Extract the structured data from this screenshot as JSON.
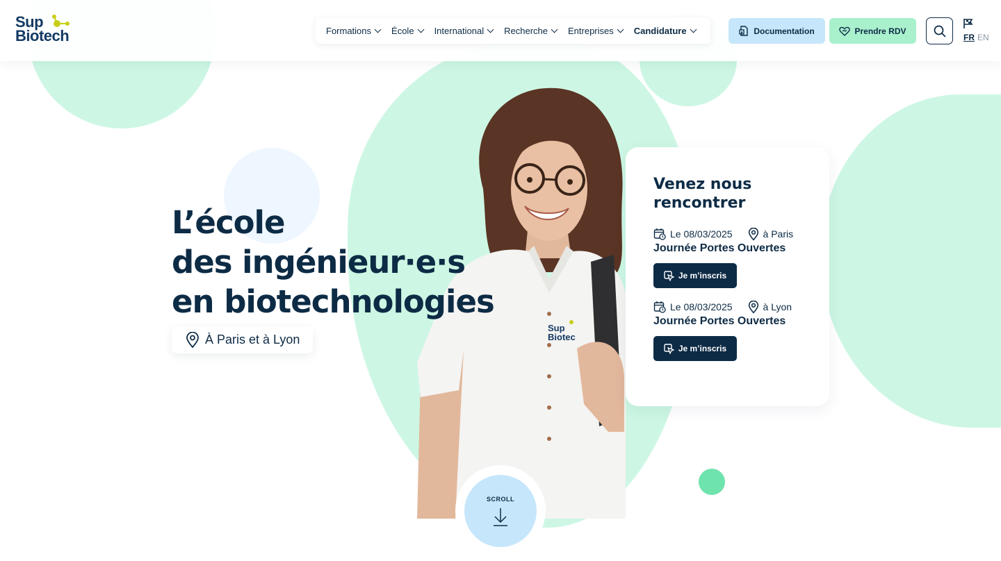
{
  "brand": {
    "logo_line1": "Sup",
    "logo_line2": "Biotech",
    "logo_color": "#133a63",
    "accent_color": "#c8cf1a"
  },
  "nav": {
    "items": [
      {
        "label": "Formations"
      },
      {
        "label": "École"
      },
      {
        "label": "International"
      },
      {
        "label": "Recherche"
      },
      {
        "label": "Entreprises"
      },
      {
        "label": "Candidature"
      }
    ]
  },
  "header_actions": {
    "documentation_label": "Documentation",
    "documentation_icon": "document-icon",
    "rdv_label": "Prendre RDV",
    "rdv_icon": "heart-handshake-icon",
    "search_icon": "search-icon",
    "lang_flag_icon": "flag-icon",
    "lang_fr": "FR",
    "lang_en": "EN"
  },
  "hero": {
    "title_line1": "L’école",
    "title_line2": "des ingénieur·e·s",
    "title_line3": "en biotechnologies",
    "location": "À Paris et à Lyon",
    "location_icon": "map-pin-icon"
  },
  "events_card": {
    "title": "Venez nous rencontrer",
    "events": [
      {
        "date": "Le 08/03/2025",
        "city": "à Paris",
        "name": "Journée Portes Ouvertes",
        "cta": "Je m’inscris"
      },
      {
        "date": "Le 08/03/2025",
        "city": "à Lyon",
        "name": "Journée Portes Ouvertes",
        "cta": "Je m’inscris"
      }
    ]
  },
  "scroll": {
    "label": "SCROLL",
    "icon": "arrow-down-icon"
  },
  "colors": {
    "navy": "#0d2b45",
    "mint": "#cdf7e4",
    "light_blue": "#c6e6fb",
    "green_button": "#a9f0cd",
    "dot_green": "#6ee3ae"
  }
}
